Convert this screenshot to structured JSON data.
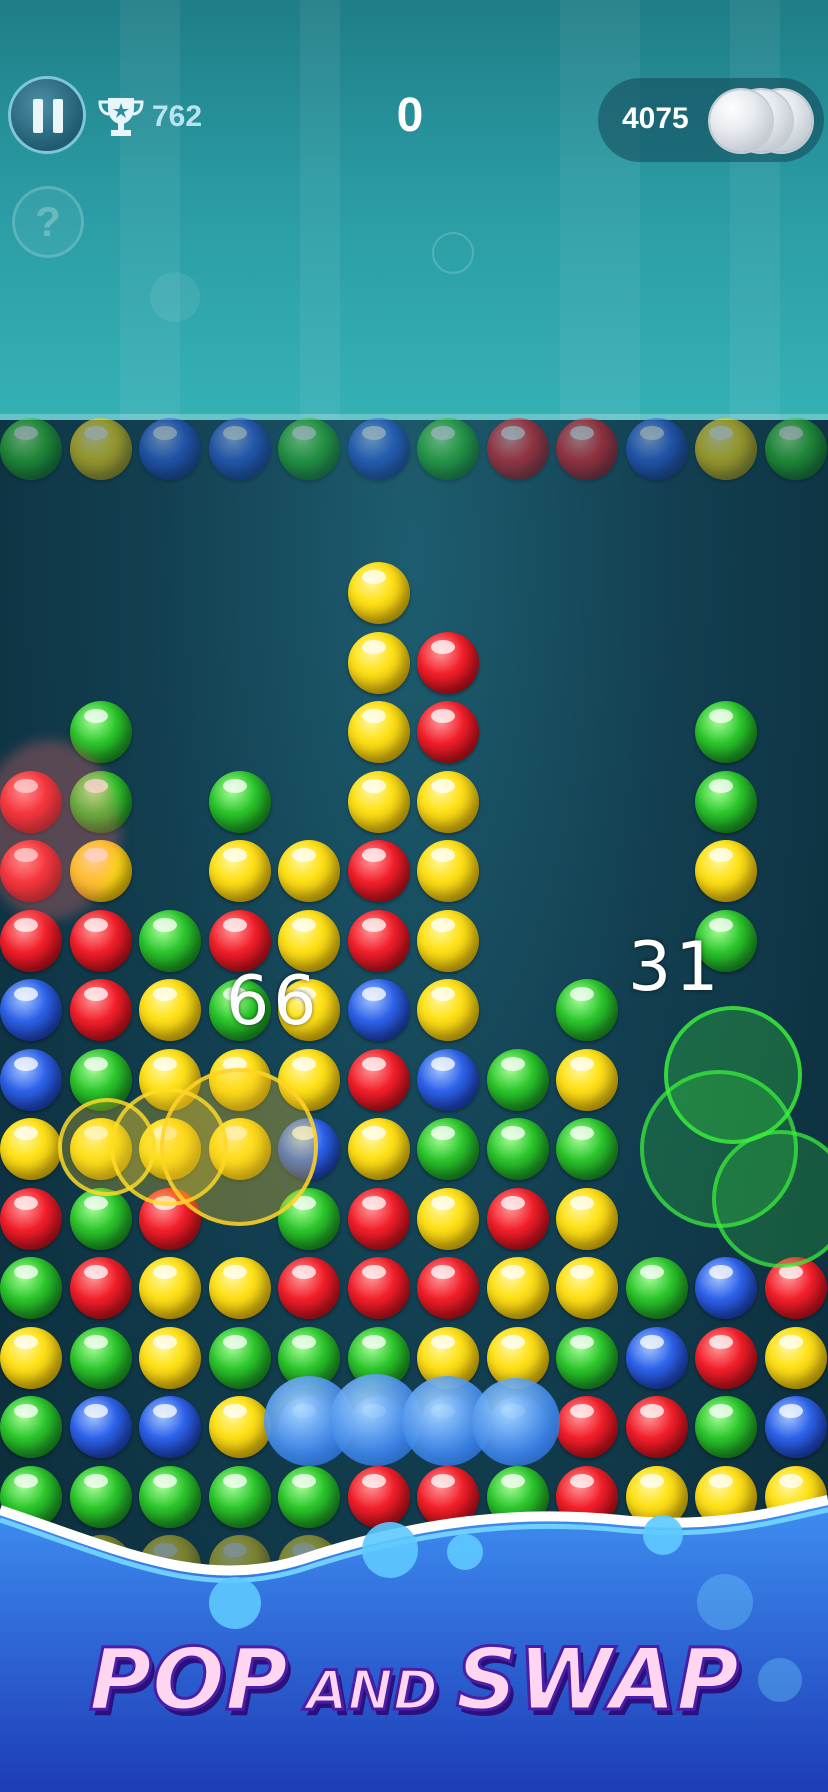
{
  "hud": {
    "best_score": "762",
    "score": "0",
    "pearls": "4075",
    "help_label": "?"
  },
  "colors": {
    "yellow": "#ffe21a",
    "red": "#f31f2a",
    "green": "#2cc62c",
    "blue": "#2d62ea"
  },
  "icons": [
    "pause-icon",
    "trophy-icon",
    "help-icon",
    "pearl-icon"
  ],
  "preview_row": [
    "g",
    "y",
    "b",
    "b",
    "g",
    "b",
    "g",
    "r",
    "r",
    "b",
    "y",
    "g"
  ],
  "board": [
    [
      null,
      null,
      null,
      null,
      null,
      "y",
      null,
      null,
      null,
      null,
      null,
      null
    ],
    [
      null,
      null,
      null,
      null,
      null,
      "y",
      "r",
      null,
      null,
      null,
      null,
      null
    ],
    [
      null,
      "g",
      null,
      null,
      null,
      "y",
      "r",
      null,
      null,
      null,
      "g",
      null
    ],
    [
      "r",
      "g",
      null,
      "g",
      null,
      "y",
      "y",
      null,
      null,
      null,
      "g",
      null
    ],
    [
      "r",
      "y",
      null,
      "y",
      "y",
      "r",
      "y",
      null,
      null,
      null,
      "y",
      null
    ],
    [
      "r",
      "r",
      "g",
      "r",
      "y",
      "r",
      "y",
      null,
      null,
      null,
      "g",
      null
    ],
    [
      "b",
      "r",
      "y",
      "g",
      "y",
      "b",
      "y",
      null,
      "g",
      null,
      null,
      null
    ],
    [
      "b",
      "g",
      "y",
      "y",
      "y",
      "r",
      "b",
      "g",
      "y",
      null,
      null,
      null
    ],
    [
      "y",
      "y",
      "y",
      "y",
      "b",
      "y",
      "g",
      "g",
      "g",
      null,
      null,
      null
    ],
    [
      "r",
      "g",
      "r",
      null,
      "g",
      "r",
      "y",
      "r",
      "y",
      null,
      null,
      null
    ],
    [
      "g",
      "r",
      "y",
      "y",
      "r",
      "r",
      "r",
      "y",
      "y",
      "g",
      "b",
      "r"
    ],
    [
      "y",
      "g",
      "y",
      "g",
      "g",
      "g",
      "y",
      "y",
      "g",
      "b",
      "r",
      "y"
    ],
    [
      "g",
      "b",
      "b",
      "y",
      "b",
      "b",
      "b",
      "b",
      "r",
      "r",
      "g",
      "b"
    ],
    [
      "g",
      "g",
      "g",
      "g",
      "g",
      "r",
      "r",
      "g",
      "r",
      "y",
      "y",
      "y"
    ],
    [
      "y",
      "y",
      "y",
      "y",
      "y",
      null,
      null,
      null,
      null,
      null,
      null,
      null
    ]
  ],
  "floating_scores": [
    "66",
    "31"
  ],
  "banner": {
    "word1": "POP",
    "word2": "AND",
    "word3": "SWAP"
  }
}
